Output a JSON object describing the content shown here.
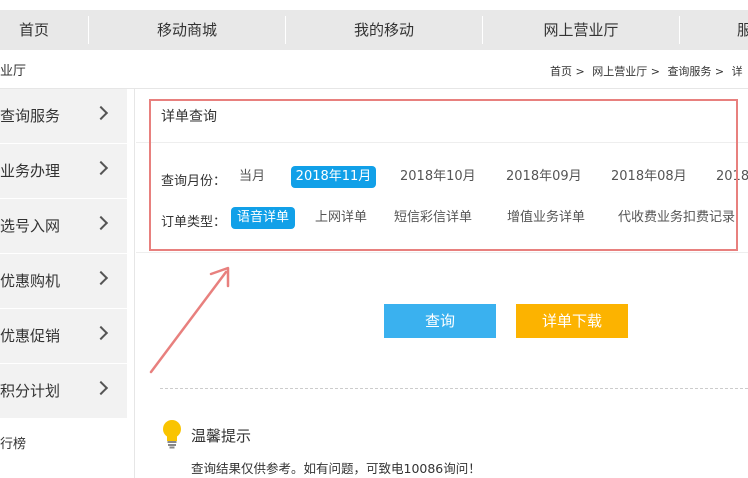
{
  "topnav": {
    "items": [
      "首页",
      "移动商城",
      "我的移动",
      "网上营业厅",
      "服"
    ]
  },
  "section_title": "业厅",
  "breadcrumb": [
    "首页 >",
    "网上营业厅 >",
    "查询服务 >",
    "详"
  ],
  "sidebar": {
    "items": [
      "查询服务",
      "业务办理",
      "选号入网",
      "优惠购机",
      "优惠促销",
      "积分计划"
    ],
    "plain_item": "行榜"
  },
  "panel": {
    "title": "详单查询",
    "month_label": "查询月份：",
    "months": [
      "当月",
      "2018年11月",
      "2018年10月",
      "2018年09月",
      "2018年08月",
      "2018"
    ],
    "selected_month": "2018年11月",
    "type_label": "订单类型：",
    "types": [
      "语音详单",
      "上网详单",
      "短信彩信详单",
      "增值业务详单",
      "代收费业务扣费记录"
    ],
    "selected_type": "语音详单"
  },
  "buttons": {
    "query": "查询",
    "download": "详单下载"
  },
  "tips": {
    "title": "温馨提示",
    "text": "查询结果仅供参考。如有问题，可致电10086询问！"
  },
  "colors": {
    "accent_blue": "#11a0e8",
    "query_button": "#3ab1ef",
    "download_button": "#fcb300",
    "annotation_red": "#e8807e"
  },
  "icons": {
    "chevron": "chevron-right-icon",
    "tip": "lightbulb-icon"
  }
}
